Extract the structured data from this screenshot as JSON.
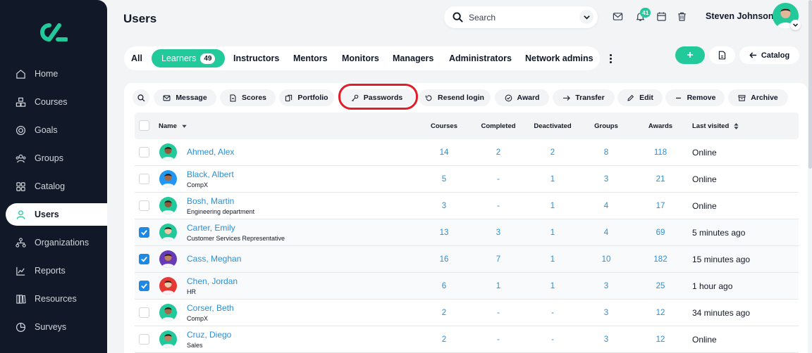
{
  "sidebar": {
    "items": [
      {
        "label": "Home",
        "icon": "home-icon"
      },
      {
        "label": "Courses",
        "icon": "courses-icon"
      },
      {
        "label": "Goals",
        "icon": "goals-icon"
      },
      {
        "label": "Groups",
        "icon": "groups-icon"
      },
      {
        "label": "Catalog",
        "icon": "catalog-icon"
      },
      {
        "label": "Users",
        "icon": "user-icon",
        "active": true
      },
      {
        "label": "Organizations",
        "icon": "organizations-icon"
      },
      {
        "label": "Reports",
        "icon": "reports-icon"
      },
      {
        "label": "Resources",
        "icon": "resources-icon"
      },
      {
        "label": "Surveys",
        "icon": "surveys-icon"
      }
    ]
  },
  "header": {
    "title": "Users",
    "search_placeholder": "Search",
    "notification_count": "41",
    "user_name": "Steven Johnson"
  },
  "tabs": [
    {
      "label": "All"
    },
    {
      "label": "Learners",
      "count": "49",
      "active": true
    },
    {
      "label": "Instructors"
    },
    {
      "label": "Mentors"
    },
    {
      "label": "Monitors"
    },
    {
      "label": "Managers"
    },
    {
      "label": "Administrators"
    },
    {
      "label": "Network admins"
    }
  ],
  "top_actions": {
    "add": "+",
    "catalog": "Catalog"
  },
  "actions": [
    "Message",
    "Scores",
    "Portfolio",
    "Passwords",
    "Resend login",
    "Award",
    "Transfer",
    "Edit",
    "Remove",
    "Archive"
  ],
  "table": {
    "headers": {
      "name": "Name",
      "courses": "Courses",
      "completed": "Completed",
      "deactivated": "Deactivated",
      "groups": "Groups",
      "awards": "Awards",
      "last_visited": "Last visited"
    },
    "rows": [
      {
        "name": "Ahmed, Alex",
        "sub": "",
        "courses": "14",
        "completed": "2",
        "deactivated": "2",
        "groups": "8",
        "awards": "118",
        "last_visited": "Online",
        "checked": false
      },
      {
        "name": "Black, Albert",
        "sub": "CompX",
        "courses": "5",
        "completed": "-",
        "deactivated": "1",
        "groups": "3",
        "awards": "21",
        "last_visited": "Online",
        "checked": false
      },
      {
        "name": "Bosh, Martin",
        "sub": "Engineering department",
        "courses": "3",
        "completed": "-",
        "deactivated": "1",
        "groups": "4",
        "awards": "17",
        "last_visited": "Online",
        "checked": false
      },
      {
        "name": "Carter, Emily",
        "sub": "Customer Services Representative",
        "courses": "13",
        "completed": "3",
        "deactivated": "1",
        "groups": "4",
        "awards": "69",
        "last_visited": "5 minutes ago",
        "checked": true
      },
      {
        "name": "Cass, Meghan",
        "sub": "",
        "courses": "16",
        "completed": "7",
        "deactivated": "1",
        "groups": "10",
        "awards": "182",
        "last_visited": "15 minutes ago",
        "checked": true
      },
      {
        "name": "Chen, Jordan",
        "sub": "HR",
        "courses": "6",
        "completed": "1",
        "deactivated": "1",
        "groups": "3",
        "awards": "25",
        "last_visited": "1 hour ago",
        "checked": true
      },
      {
        "name": "Corser, Beth",
        "sub": "CompX",
        "courses": "2",
        "completed": "-",
        "deactivated": "-",
        "groups": "3",
        "awards": "12",
        "last_visited": "34 minutes ago",
        "checked": false
      },
      {
        "name": "Cruz, Diego",
        "sub": "Sales",
        "courses": "2",
        "completed": "-",
        "deactivated": "-",
        "groups": "3",
        "awards": "12",
        "last_visited": "Online",
        "checked": false
      }
    ]
  },
  "colors": {
    "accent": "#22c99a",
    "sidebar": "#111827",
    "link": "#2d8fd0",
    "highlight": "#e11d2a",
    "checkbox": "#1e88e5"
  }
}
